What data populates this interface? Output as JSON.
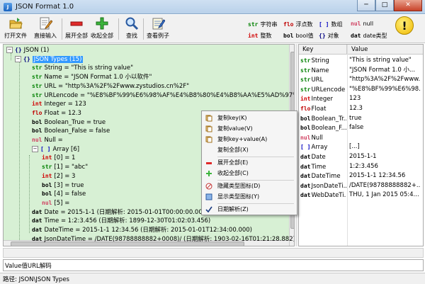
{
  "window": {
    "title": "JSON Format 1.0",
    "minimize": "─",
    "maximize": "□",
    "close": "✕"
  },
  "toolbar": {
    "buttons": [
      {
        "name": "open-file",
        "label": "打开文件"
      },
      {
        "name": "direct-input",
        "label": "直接输入"
      },
      {
        "name": "expand-all",
        "label": "展开全部"
      },
      {
        "name": "collapse-all",
        "label": "收起全部"
      },
      {
        "name": "search",
        "label": "查找"
      },
      {
        "name": "view-example",
        "label": "查看例子"
      }
    ]
  },
  "legend": [
    {
      "tag": "str",
      "label": "字符串",
      "color": "#008000"
    },
    {
      "tag": "flo",
      "label": "浮点数",
      "color": "#c00000"
    },
    {
      "tag": "[ ]",
      "label": "数组",
      "color": "#0000c0"
    },
    {
      "tag": "nul",
      "label": "null",
      "color": "#d04060"
    },
    {
      "tag": "int",
      "label": "整数",
      "color": "#d00000"
    },
    {
      "tag": "bol",
      "label": "bool值",
      "color": "#000000"
    },
    {
      "tag": "{}",
      "label": "对象",
      "color": "#000080"
    },
    {
      "tag": "dat",
      "label": "date类型",
      "color": "#000000"
    }
  ],
  "help_icon": "!",
  "tree": {
    "rows": [
      {
        "indent": 0,
        "exp": "−",
        "tag": "{}",
        "tagColor": "#000080",
        "text": "JSON (1)"
      },
      {
        "indent": 1,
        "exp": "−",
        "tag": "{}",
        "tagColor": "#000080",
        "text": "JSON Types (15)",
        "selected": true
      },
      {
        "indent": 2,
        "tag": "str",
        "tagColor": "#008000",
        "text": "String = \"This is string value\""
      },
      {
        "indent": 2,
        "tag": "str",
        "tagColor": "#008000",
        "text": "Name = \"JSON Format 1.0 小以软件\""
      },
      {
        "indent": 2,
        "tag": "str",
        "tagColor": "#008000",
        "text": "URL = \"http%3A%2F%2Fwww.zystudios.cn%2F\""
      },
      {
        "indent": 2,
        "tag": "str",
        "tagColor": "#008000",
        "text": "URLencode = \"%E8%BF%99%E6%98%AF%E4%B8%80%E4%B8%AA%E5%AD%97%E7%AC"
      },
      {
        "indent": 2,
        "tag": "int",
        "tagColor": "#d00000",
        "text": "Integer = 123"
      },
      {
        "indent": 2,
        "tag": "flo",
        "tagColor": "#c00000",
        "text": "Float = 12.3"
      },
      {
        "indent": 2,
        "tag": "bol",
        "tagColor": "#000000",
        "text": "Boolean_True = true"
      },
      {
        "indent": 2,
        "tag": "bol",
        "tagColor": "#000000",
        "text": "Boolean_False = false"
      },
      {
        "indent": 2,
        "tag": "nul",
        "tagColor": "#d04060",
        "text": "Null ="
      },
      {
        "indent": 2,
        "exp": "−",
        "tag": "[ ]",
        "tagColor": "#0000c0",
        "text": "Array [6]"
      },
      {
        "indent": 3,
        "tag": "int",
        "tagColor": "#d00000",
        "text": "[0] = 1"
      },
      {
        "indent": 3,
        "tag": "str",
        "tagColor": "#008000",
        "text": "[1] = \"abc\""
      },
      {
        "indent": 3,
        "tag": "int",
        "tagColor": "#d00000",
        "text": "[2] = 3"
      },
      {
        "indent": 3,
        "tag": "bol",
        "tagColor": "#000000",
        "text": "[3] = true"
      },
      {
        "indent": 3,
        "tag": "bol",
        "tagColor": "#000000",
        "text": "[4] = false"
      },
      {
        "indent": 3,
        "tag": "nul",
        "tagColor": "#d04060",
        "text": "[5] ="
      },
      {
        "indent": 2,
        "tag": "dat",
        "tagColor": "#000000",
        "text": "Date = 2015-1-1 (日期解析: 2015-01-01T00:00:00.000)"
      },
      {
        "indent": 2,
        "tag": "dat",
        "tagColor": "#000000",
        "text": "Time = 1:2:3.456 (日期解析: 1899-12-30T01:02:03.456)"
      },
      {
        "indent": 2,
        "tag": "dat",
        "tagColor": "#000000",
        "text": "DateTime = 2015-1-1 12:34.56 (日期解析: 2015-01-01T12:34:00.000)"
      },
      {
        "indent": 2,
        "tag": "dat",
        "tagColor": "#000000",
        "text": "JsonDateTime = /DATE(98788888882+0008)/ (日期解析: 1903-02-16T01:21:28.882)"
      }
    ]
  },
  "context_menu": {
    "items": [
      {
        "label": "复制key(K)",
        "icon": "copy",
        "sep_after": false
      },
      {
        "label": "复制value(V)",
        "icon": "copy",
        "sep_after": false
      },
      {
        "label": "复制key+value(A)",
        "icon": "copy",
        "sep_after": false
      },
      {
        "label": "复制全部(X)",
        "icon": "none",
        "sep_after": true
      },
      {
        "label": "展开全部(E)",
        "icon": "minus",
        "sep_after": false
      },
      {
        "label": "收起全部(C)",
        "icon": "plus",
        "sep_after": true
      },
      {
        "label": "隐藏类型图标(D)",
        "icon": "hide",
        "sep_after": false
      },
      {
        "label": "显示类型图标(Y)",
        "icon": "show",
        "sep_after": true
      },
      {
        "label": "日期解析(Z)",
        "icon": "check",
        "sep_after": false
      }
    ]
  },
  "grid": {
    "headers": {
      "key": "Key",
      "value": "Value"
    },
    "rows": [
      {
        "tag": "str",
        "tagColor": "#008000",
        "key": "String",
        "value": "\"This is string value\""
      },
      {
        "tag": "str",
        "tagColor": "#008000",
        "key": "Name",
        "value": "\"JSON Format 1.0 小..."
      },
      {
        "tag": "str",
        "tagColor": "#008000",
        "key": "URL",
        "value": "\"http%3A%2F%2Fwww..."
      },
      {
        "tag": "str",
        "tagColor": "#008000",
        "key": "URLencode",
        "value": "\"%E8%BF%99%E6%98..."
      },
      {
        "tag": "int",
        "tagColor": "#d00000",
        "key": "Integer",
        "value": "123"
      },
      {
        "tag": "flo",
        "tagColor": "#c00000",
        "key": "Float",
        "value": "12.3"
      },
      {
        "tag": "bol",
        "tagColor": "#000000",
        "key": "Boolean_Tr...",
        "value": "true"
      },
      {
        "tag": "bol",
        "tagColor": "#000000",
        "key": "Boolean_F...",
        "value": "false"
      },
      {
        "tag": "nul",
        "tagColor": "#d04060",
        "key": "Null",
        "value": ""
      },
      {
        "tag": "[ ]",
        "tagColor": "#0000c0",
        "key": "Array",
        "value": "[...]"
      },
      {
        "tag": "dat",
        "tagColor": "#000000",
        "key": "Date",
        "value": "2015-1-1"
      },
      {
        "tag": "dat",
        "tagColor": "#000000",
        "key": "Time",
        "value": "1:2:3.456"
      },
      {
        "tag": "dat",
        "tagColor": "#000000",
        "key": "DateTime",
        "value": "2015-1-1 12:34.56"
      },
      {
        "tag": "dat",
        "tagColor": "#000000",
        "key": "JsonDateTi...",
        "value": "/DATE(98788888882+..."
      },
      {
        "tag": "dat",
        "tagColor": "#000000",
        "key": "WebDateTi...",
        "value": "THU, 1 Jan 2015 05:4..."
      }
    ]
  },
  "bottom": {
    "label": "Value值URL解码"
  },
  "status": {
    "path": "路径: JSON\\JSON Types"
  }
}
